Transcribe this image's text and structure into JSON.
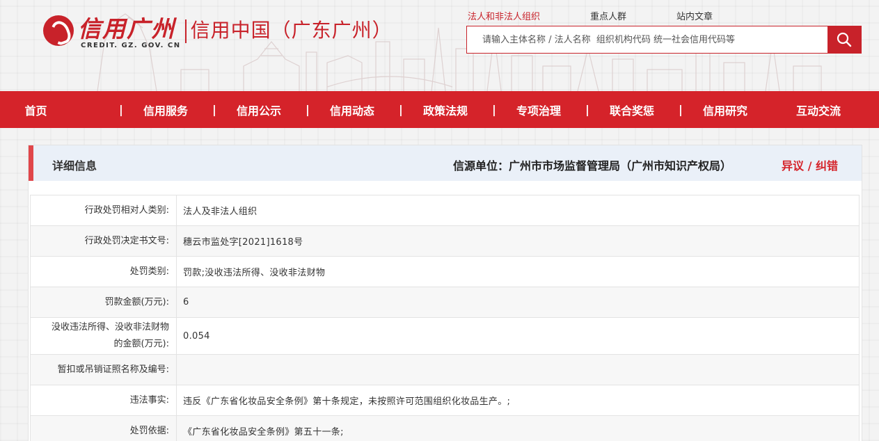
{
  "header": {
    "logo_main": "信用广州",
    "logo_en": "CREDIT. GZ. GOV. CN",
    "logo_sub": "信用中国（广东广州）"
  },
  "search": {
    "tabs": [
      "法人和非法人组织",
      "重点人群",
      "站内文章"
    ],
    "active_tab": "法人和非法人组织",
    "placeholder": "请输入主体名称 / 法人名称  组织机构代码 统一社会信用代码等"
  },
  "nav": {
    "items": [
      "首页",
      "信用服务",
      "信用公示",
      "信用动态",
      "政策法规",
      "专项治理",
      "联合奖惩",
      "信用研究",
      "互动交流"
    ],
    "separator": "|"
  },
  "panel": {
    "title": "详细信息",
    "source": "信源单位：广州市市场监督管理局（广州市知识产权局）",
    "objection": "异议 / 纠错"
  },
  "details": {
    "rows": [
      {
        "label": "行政处罚相对人类别:",
        "value": "法人及非法人组织"
      },
      {
        "label": "行政处罚决定书文号:",
        "value": "穗云市监处字[2021]1618号"
      },
      {
        "label": "处罚类别:",
        "value": "罚款;没收违法所得、没收非法财物"
      },
      {
        "label": "罚款金额(万元):",
        "value": "6"
      },
      {
        "label_line1": "没收违法所得、没收非法财物",
        "label_line2": "的金额(万元):",
        "value": "0.054"
      },
      {
        "label": "暂扣或吊销证照名称及编号:",
        "value": ""
      },
      {
        "label": "违法事实:",
        "value": "违反《广东省化妆品安全条例》第十条规定，未按照许可范围组织化妆品生产。;"
      },
      {
        "label": "处罚依据:",
        "value": "《广东省化妆品安全条例》第五十一条;"
      }
    ]
  },
  "colors": {
    "brand_red": "#d5232a",
    "header_panel_bg": "#eaf0f8",
    "accent_bar": "#e0464a"
  }
}
